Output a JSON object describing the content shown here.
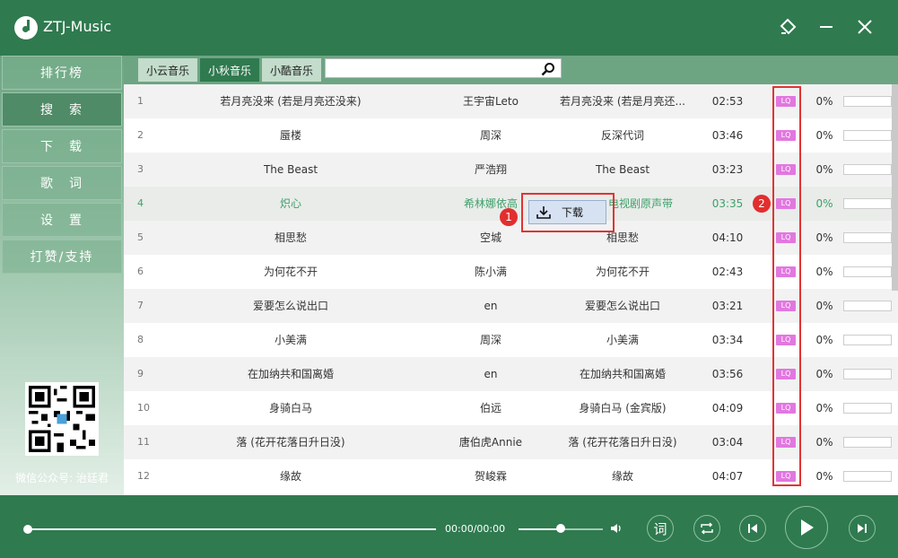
{
  "app": {
    "title": "ZTJ-Music"
  },
  "sidebar": {
    "items": [
      {
        "label": "排行榜",
        "active": false
      },
      {
        "label": "搜　索",
        "active": true
      },
      {
        "label": "下　载",
        "active": false
      },
      {
        "label": "歌　词",
        "active": false
      },
      {
        "label": "设　置",
        "active": false
      },
      {
        "label": "打赞/支持",
        "active": false
      }
    ],
    "wechat": "微信公众号: 治廷君"
  },
  "tabs": [
    {
      "label": "小云音乐",
      "active": false
    },
    {
      "label": "小秋音乐",
      "active": true
    },
    {
      "label": "小酷音乐",
      "active": false
    }
  ],
  "search": {
    "value": "",
    "placeholder": ""
  },
  "songs": [
    {
      "idx": "1",
      "title": "若月亮没来 (若是月亮还没来)",
      "artist": "王宇宙Leto",
      "album": "若月亮没来 (若是月亮还...",
      "duration": "02:53",
      "quality": "LQ",
      "progress": "0%"
    },
    {
      "idx": "2",
      "title": "蜃楼",
      "artist": "周深",
      "album": "反深代词",
      "duration": "03:46",
      "quality": "LQ",
      "progress": "0%"
    },
    {
      "idx": "3",
      "title": "The Beast",
      "artist": "严浩翔",
      "album": "The Beast",
      "duration": "03:23",
      "quality": "LQ",
      "progress": "0%"
    },
    {
      "idx": "4",
      "title": "炽心",
      "artist": "希林娜依高",
      "album": "电视剧原声带",
      "duration": "03:35",
      "quality": "LQ",
      "progress": "0%"
    },
    {
      "idx": "5",
      "title": "相思愁",
      "artist": "空城",
      "album": "相思愁",
      "duration": "04:10",
      "quality": "LQ",
      "progress": "0%"
    },
    {
      "idx": "6",
      "title": "为何花不开",
      "artist": "陈小满",
      "album": "为何花不开",
      "duration": "02:43",
      "quality": "LQ",
      "progress": "0%"
    },
    {
      "idx": "7",
      "title": "爱要怎么说出口",
      "artist": "en",
      "album": "爱要怎么说出口",
      "duration": "03:21",
      "quality": "LQ",
      "progress": "0%"
    },
    {
      "idx": "8",
      "title": "小美满",
      "artist": "周深",
      "album": "小美满",
      "duration": "03:34",
      "quality": "LQ",
      "progress": "0%"
    },
    {
      "idx": "9",
      "title": "在加纳共和国离婚",
      "artist": "en",
      "album": "在加纳共和国离婚",
      "duration": "03:56",
      "quality": "LQ",
      "progress": "0%"
    },
    {
      "idx": "10",
      "title": "身骑白马",
      "artist": "伯远",
      "album": "身骑白马 (金宾版)",
      "duration": "04:09",
      "quality": "LQ",
      "progress": "0%"
    },
    {
      "idx": "11",
      "title": "落 (花开花落日升日没)",
      "artist": "唐伯虎Annie",
      "album": "落 (花开花落日升日没)",
      "duration": "03:04",
      "quality": "LQ",
      "progress": "0%"
    },
    {
      "idx": "12",
      "title": "缘故",
      "artist": "贺峻霖",
      "album": "缘故",
      "duration": "04:07",
      "quality": "LQ",
      "progress": "0%"
    }
  ],
  "context_menu": {
    "label": "下载"
  },
  "badges": [
    "1",
    "2"
  ],
  "player": {
    "time": "00:00/00:00",
    "progress": 0,
    "volume": 0.5,
    "lyrics_label": "词"
  },
  "colors": {
    "brand": "#2f7a4f",
    "quality_badge": "#e277e0",
    "annotation": "#e23333",
    "highlight_text": "#3ea06a"
  }
}
